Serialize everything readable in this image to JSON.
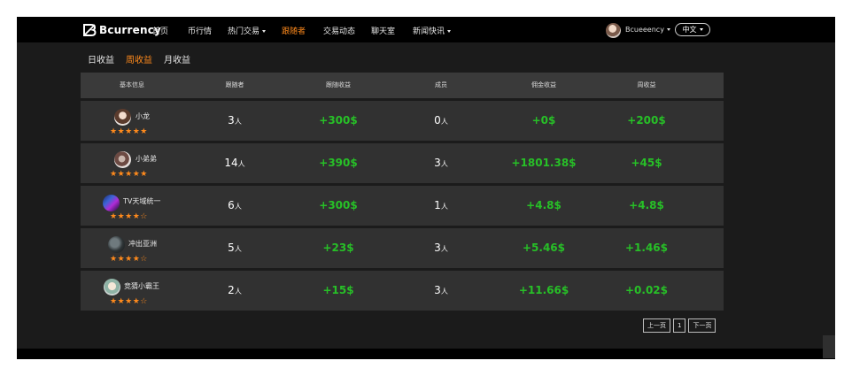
{
  "brand": {
    "logo_text": "Bcurrency"
  },
  "nav": {
    "items": [
      {
        "label": "首页"
      },
      {
        "label": "币行情"
      },
      {
        "label": "热门交易"
      },
      {
        "label": "跟随者"
      },
      {
        "label": "交易动态"
      },
      {
        "label": "聊天室"
      },
      {
        "label": "新闻快讯"
      }
    ],
    "active": "跟随者"
  },
  "user": {
    "name": "Bcueeency",
    "language": "中文"
  },
  "periods": {
    "items": [
      "日收益",
      "周收益",
      "月收益"
    ],
    "active": "周收益"
  },
  "table": {
    "headers": [
      "基本信息",
      "跟随者",
      "跟随收益",
      "成员",
      "佣金收益",
      "周收益"
    ],
    "unit": "人",
    "rows": [
      {
        "name": "小龙",
        "rating": 5,
        "stars": "★★★★★",
        "followers": "3",
        "follow_profit": "+300$",
        "members": "0",
        "commission": "+0$",
        "weekly": "+200$"
      },
      {
        "name": "小弟弟",
        "rating": 5,
        "stars": "★★★★★",
        "followers": "14",
        "follow_profit": "+390$",
        "members": "3",
        "commission": "+1801.38$",
        "weekly": "+45$"
      },
      {
        "name": "TV天域统一",
        "rating": 4,
        "stars": "★★★★☆",
        "followers": "6",
        "follow_profit": "+300$",
        "members": "1",
        "commission": "+4.8$",
        "weekly": "+4.8$"
      },
      {
        "name": "冲出亚洲",
        "rating": 4,
        "stars": "★★★★☆",
        "followers": "5",
        "follow_profit": "+23$",
        "members": "3",
        "commission": "+5.46$",
        "weekly": "+1.46$"
      },
      {
        "name": "竞猜小霸王",
        "rating": 4,
        "stars": "★★★★☆",
        "followers": "2",
        "follow_profit": "+15$",
        "members": "3",
        "commission": "+11.66$",
        "weekly": "+0.02$"
      }
    ]
  },
  "pagination": {
    "prev": "上一页",
    "current": "1",
    "next": "下一页"
  },
  "colors": {
    "accent": "#ff8a1c",
    "profit": "#27c027",
    "background": "#1b1b1b",
    "topbar": "#000000"
  }
}
